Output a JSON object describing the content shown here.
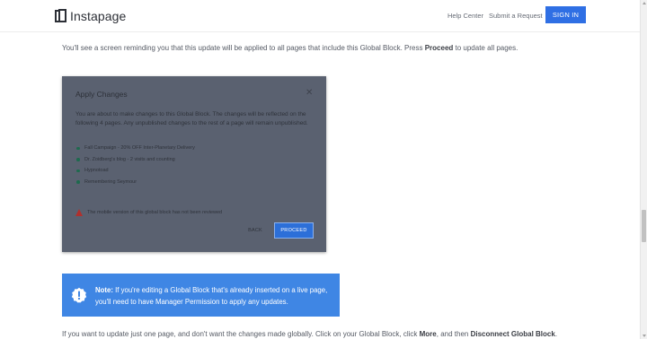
{
  "header": {
    "logo_text": "Instapage",
    "nav": {
      "help": "Help Center",
      "submit": "Submit a Request"
    },
    "signin_label": "SIGN IN",
    "accent_color": "#2f6fe4"
  },
  "intro": {
    "before": "You'll see a screen reminding you that this update will be applied to all pages that include this Global Block. Press ",
    "bold": "Proceed",
    "after": " to update all pages."
  },
  "modal": {
    "title": "Apply Changes",
    "close_glyph": "✕",
    "description": "You are about to make changes to this Global Block. The changes will be reflected on the following 4 pages. Any unpublished changes to the rest of a page will remain unpublished.",
    "pages": [
      "Fall Campaign - 20% OFF Inter-Planetary Delivery",
      "Dr. Zoidberg's blog - 2 visits and counting",
      "Hypnotoad",
      "Remembering Seymour"
    ],
    "warning": "The mobile version of this global block has not been reviewed",
    "back_label": "BACK",
    "proceed_label": "PROCEED"
  },
  "note": {
    "label": "Note:",
    "text": " If you're editing a Global Block that's already inserted on a live page, you'll need to have Manager Permission to apply any updates.",
    "icon": "exclamation-icon",
    "color": "#3f86e4"
  },
  "outro": {
    "p1": "If you want to update just one page, and don't want the changes made globally. Click on your Global Block, click ",
    "b1": "More",
    "p2": ", and then ",
    "b2": "Disconnect Global Block",
    "p3": "."
  }
}
